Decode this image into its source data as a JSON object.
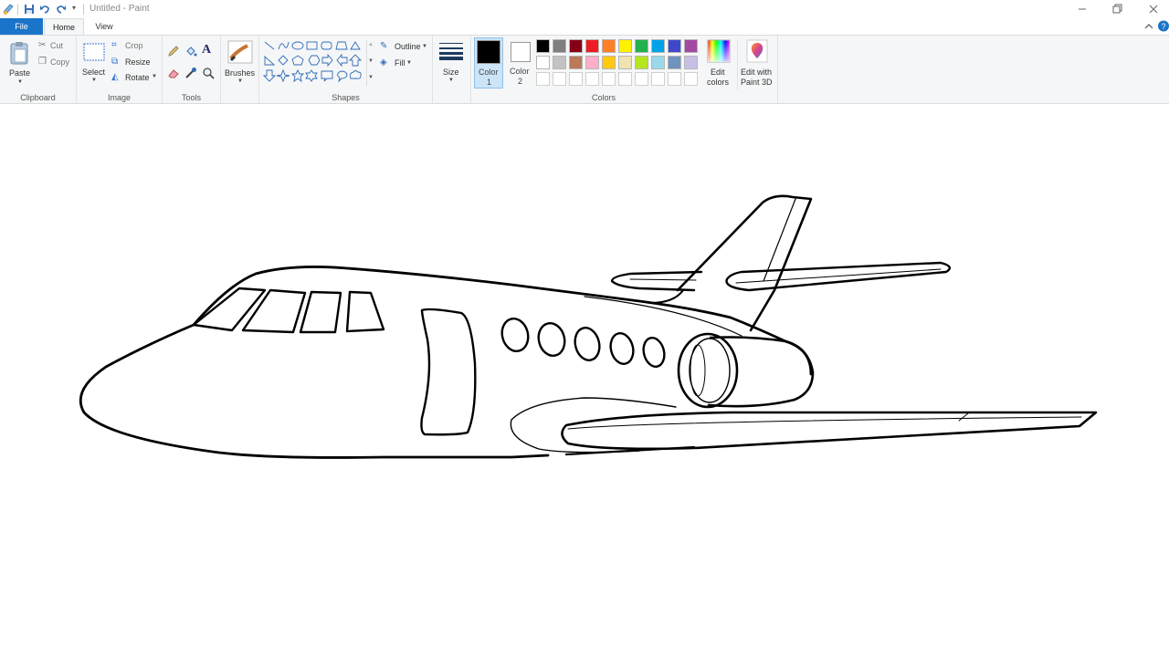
{
  "window": {
    "title": "Untitled - Paint"
  },
  "tabs": {
    "file": "File",
    "home": "Home",
    "view": "View"
  },
  "clipboard": {
    "paste": "Paste",
    "cut": "Cut",
    "copy": "Copy",
    "group": "Clipboard"
  },
  "image": {
    "select": "Select",
    "crop": "Crop",
    "resize": "Resize",
    "rotate": "Rotate",
    "group": "Image"
  },
  "tools": {
    "group": "Tools"
  },
  "brushes": {
    "label": "Brushes"
  },
  "shapes": {
    "outline": "Outline",
    "fill": "Fill",
    "group": "Shapes"
  },
  "size": {
    "label": "Size"
  },
  "colors": {
    "color1_label": "Color",
    "color1_num": "1",
    "color2_label": "Color",
    "color2_num": "2",
    "edit_colors_1": "Edit",
    "edit_colors_2": "colors",
    "paint3d_1": "Edit with",
    "paint3d_2": "Paint 3D",
    "group": "Colors",
    "color1": "#000000",
    "color2": "#ffffff",
    "row1": [
      "#000000",
      "#7f7f7f",
      "#880015",
      "#ed1c24",
      "#ff7f27",
      "#fff200",
      "#22b14c",
      "#00a2e8",
      "#3f48cc",
      "#a349a4"
    ],
    "row2": [
      "#ffffff",
      "#c3c3c3",
      "#b97a57",
      "#ffaec9",
      "#ffc90e",
      "#efe4b0",
      "#b5e61d",
      "#99d9ea",
      "#7092be",
      "#c8bfe7"
    ],
    "row3": [
      "#ffffff",
      "#ffffff",
      "#ffffff",
      "#ffffff",
      "#ffffff",
      "#ffffff",
      "#ffffff",
      "#ffffff",
      "#ffffff",
      "#ffffff"
    ]
  }
}
